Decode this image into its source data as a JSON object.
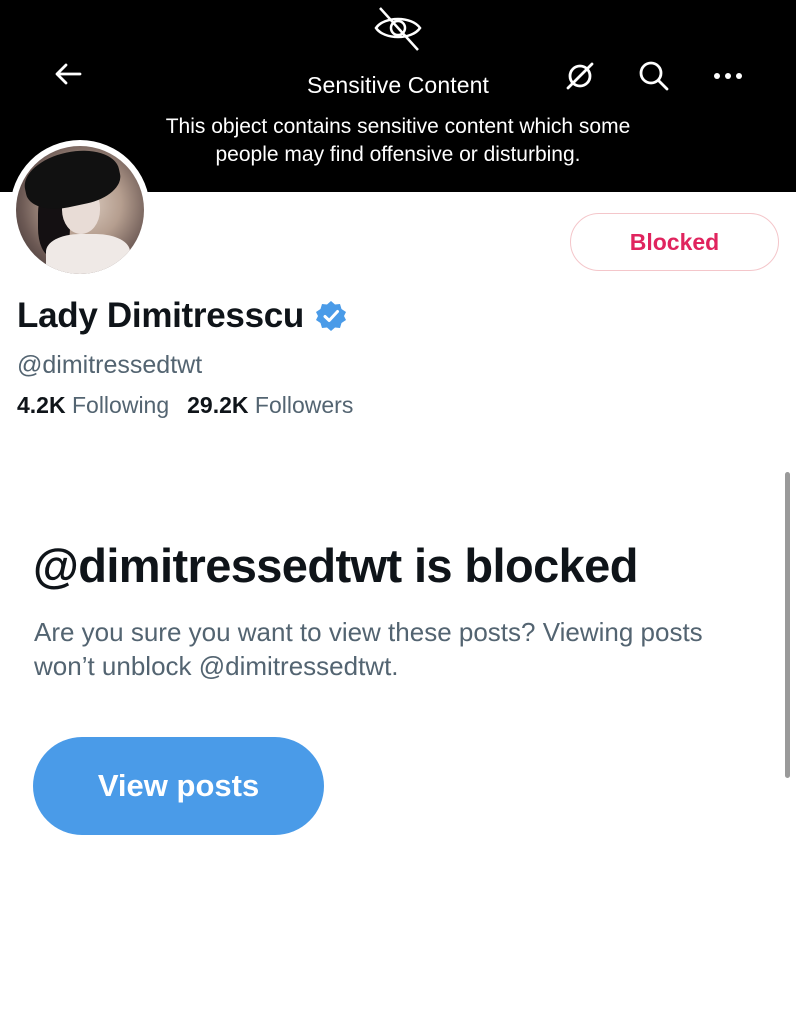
{
  "banner": {
    "title": "Sensitive Content",
    "description": "This object contains sensitive content which some people may find offensive or disturbing.",
    "icons": [
      "eye-slash-icon",
      "back-arrow-icon",
      "reveal-icon",
      "search-icon",
      "more-icon"
    ]
  },
  "profile": {
    "display_name": "Lady Dimitresscu",
    "handle": "@dimitressedtwt",
    "verified": true,
    "following_count": "4.2K",
    "following_label": "Following",
    "followers_count": "29.2K",
    "followers_label": "Followers",
    "blocked_button_label": "Blocked"
  },
  "blocked_notice": {
    "heading": "@dimitressedtwt is blocked",
    "description": "Are you sure you want to view these posts? Viewing posts won’t unblock @dimitressedtwt.",
    "button_label": "View posts"
  },
  "colors": {
    "banner_bg": "#000000",
    "accent_blue": "#4a9be8",
    "blocked_red": "#e0245e",
    "secondary_text": "#536471",
    "primary_text": "#0f1419"
  }
}
